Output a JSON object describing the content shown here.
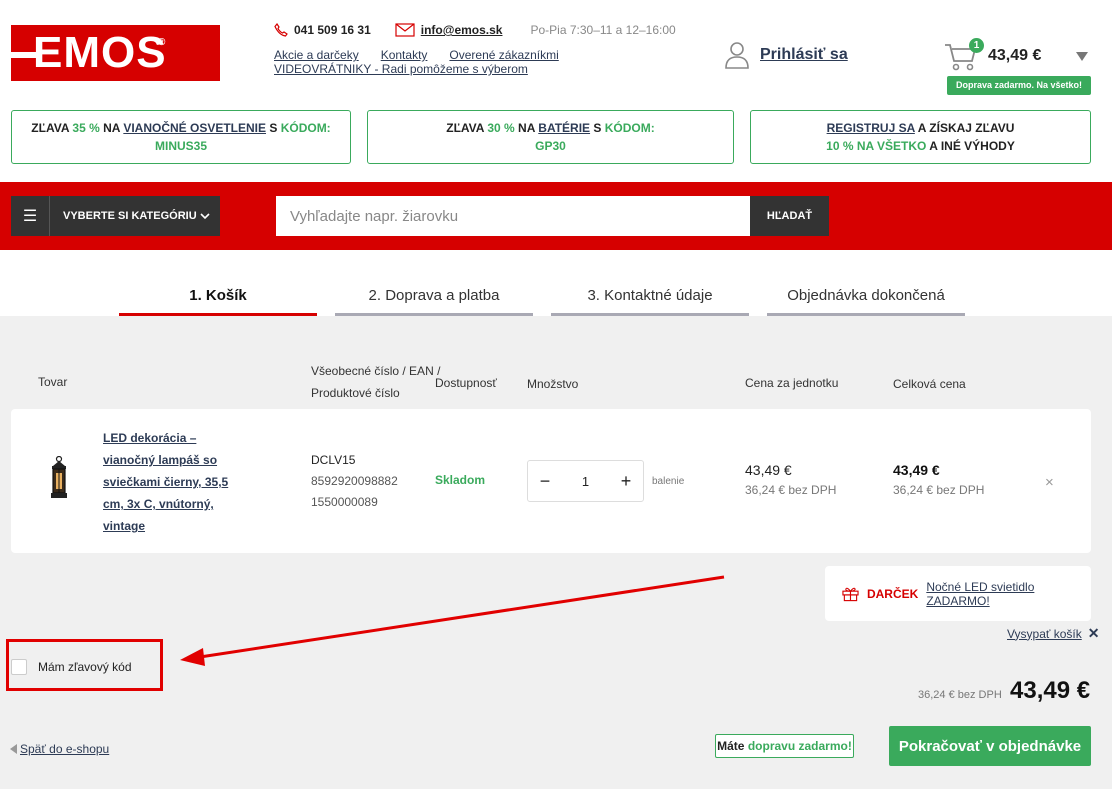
{
  "header": {
    "logo_text": "EMOS",
    "phone": "041 509 16 31",
    "email": "info@emos.sk",
    "hours": "Po-Pia 7:30–11 a 12–16:00",
    "links": [
      "Akcie a darčeky",
      "Kontakty",
      "Overené zákazníkmi"
    ],
    "link_video": "VIDEOVRÁTNIKY - Radi pomôžeme s výberom",
    "login_label": "Prihlásiť sa",
    "cart_count": "1",
    "cart_price": "43,49 €",
    "free_shipping": "Doprava zadarmo. Na všetko!"
  },
  "promos": [
    {
      "p1": "ZĽAVA ",
      "g1": "35 %",
      "p2": " NA ",
      "u1": "VIANOČNÉ OSVETLENIE",
      "p3": " S ",
      "g2": "KÓDOM:",
      "code": "MINUS35"
    },
    {
      "p1": "ZĽAVA ",
      "g1": "30 %",
      "p2": " NA ",
      "u1": "BATÉRIE",
      "p3": " S ",
      "g2": "KÓDOM:",
      "code": "GP30"
    },
    {
      "u1": "REGISTRUJ SA",
      "p1": " A ZÍSKAJ ZĽAVU",
      "g1": "10 % NA VŠETKO",
      "p2": " A INÉ VÝHODY"
    }
  ],
  "nav": {
    "category_label": "VYBERTE SI KATEGÓRIU",
    "search_placeholder": "Vyhľadajte napr. žiarovku",
    "search_button": "HĽADAŤ"
  },
  "steps": [
    "1. Košík",
    "2. Doprava a platba",
    "3. Kontaktné údaje",
    "Objednávka dokončená"
  ],
  "table": {
    "headers": {
      "product": "Tovar",
      "codes_1": "Všeobecné číslo / EAN /",
      "codes_2": "Produktové číslo",
      "availability": "Dostupnosť",
      "quantity": "Množstvo",
      "unit_price": "Cena za jednotku",
      "total_price": "Celková cena"
    },
    "item": {
      "name": "LED dekorácia – vianočný lampáš so sviečkami čierny, 35,5 cm, 3x C, vnútorný, vintage",
      "code": "DCLV15",
      "ean": "8592920098882",
      "product_no": "1550000089",
      "stock": "Skladom",
      "qty_minus": "−",
      "qty": "1",
      "qty_plus": "+",
      "unit": "balenie",
      "unit_price": "43,49 €",
      "unit_net": "36,24 € bez DPH",
      "total_price": "43,49 €",
      "total_net": "36,24 € bez DPH",
      "remove": "×"
    }
  },
  "gift": {
    "label": "DARČEK",
    "link": "Nočné LED svietidlo ZADARMO!"
  },
  "empty_cart": "Vysypať košík",
  "empty_cart_x": "✕",
  "coupon_label": "Mám zľavový kód",
  "summary": {
    "net": "36,24 € bez DPH",
    "total": "43,49 €"
  },
  "footer": {
    "back": "Späť do e-shopu",
    "free_pre": "Máte ",
    "free_green": "dopravu zadarmo!",
    "continue": "Pokračovať v objednávke"
  },
  "colors": {
    "brand_red": "#d60000",
    "green": "#3aaa5c",
    "dark": "#333333"
  }
}
